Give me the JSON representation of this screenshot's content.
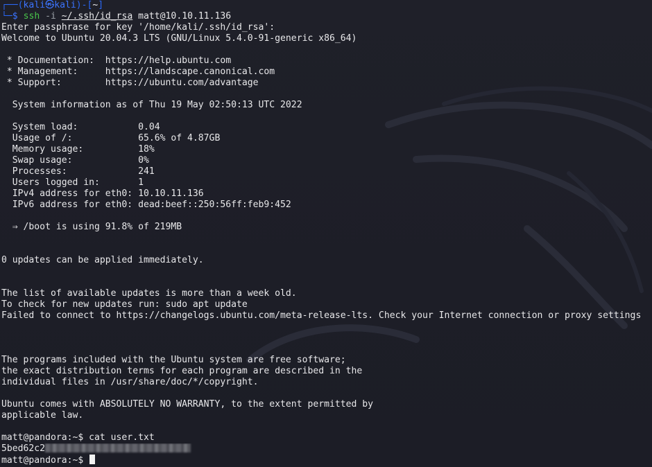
{
  "prompt": {
    "top_left": "┌──(",
    "user": "kali",
    "skull": "㉿",
    "host": "kali",
    "mid": ")-[",
    "dir": "~",
    "end": "]",
    "bottom_left": "└─",
    "dollar": "$ ",
    "command": "ssh",
    "option": " -i ",
    "keyfile": "~/.ssh/id_rsa",
    "target": " matt@10.10.11.136"
  },
  "output": [
    "Enter passphrase for key '/home/kali/.ssh/id_rsa':",
    "Welcome to Ubuntu 20.04.3 LTS (GNU/Linux 5.4.0-91-generic x86_64)",
    "",
    " * Documentation:  https://help.ubuntu.com",
    " * Management:     https://landscape.canonical.com",
    " * Support:        https://ubuntu.com/advantage",
    "",
    "  System information as of Thu 19 May 02:50:13 UTC 2022",
    "",
    "  System load:           0.04",
    "  Usage of /:            65.6% of 4.87GB",
    "  Memory usage:          18%",
    "  Swap usage:            0%",
    "  Processes:             241",
    "  Users logged in:       1",
    "  IPv4 address for eth0: 10.10.11.136",
    "  IPv6 address for eth0: dead:beef::250:56ff:feb9:452",
    "",
    "  ⇒ /boot is using 91.8% of 219MB",
    "",
    "",
    "0 updates can be applied immediately.",
    "",
    "",
    "The list of available updates is more than a week old.",
    "To check for new updates run: sudo apt update",
    "Failed to connect to https://changelogs.ubuntu.com/meta-release-lts. Check your Internet connection or proxy settings",
    "",
    "",
    "",
    "The programs included with the Ubuntu system are free software;",
    "the exact distribution terms for each program are described in the",
    "individual files in /usr/share/doc/*/copyright.",
    "",
    "Ubuntu comes with ABSOLUTELY NO WARRANTY, to the extent permitted by",
    "applicable law.",
    ""
  ],
  "session": {
    "cmd_line": "matt@pandora:~$ cat user.txt",
    "flag_visible": "5bed62c2",
    "final_prompt": "matt@pandora:~$ "
  },
  "colors": {
    "background": "#1e1f29",
    "prompt_blue": "#3c74ff",
    "command_green": "#49c44b",
    "text": "#e8e8ea"
  }
}
